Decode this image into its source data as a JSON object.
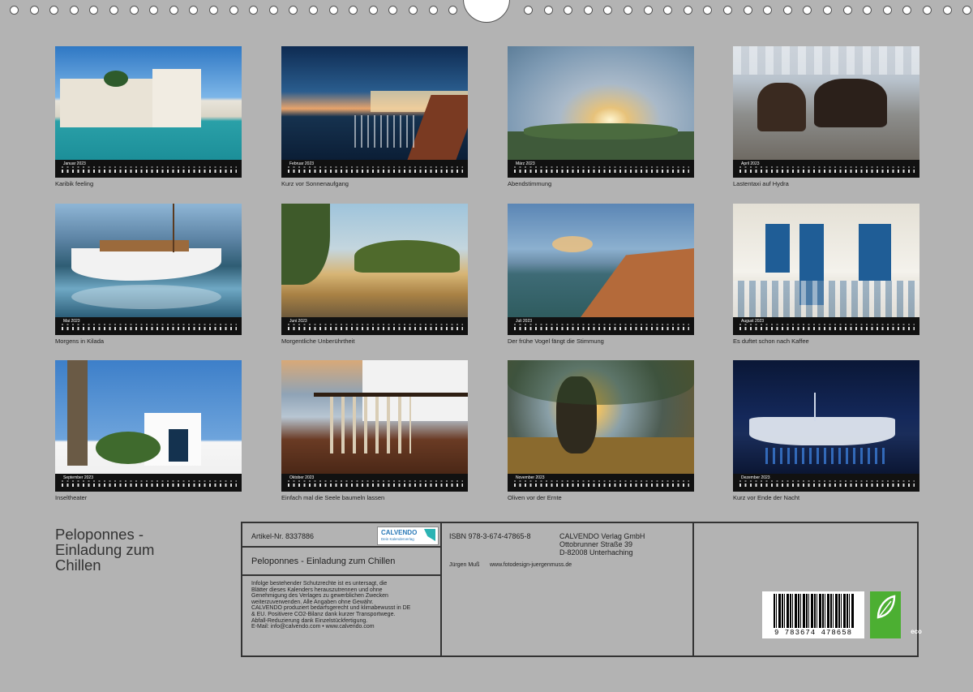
{
  "months": [
    {
      "label": "Januar 2023",
      "caption": "Karibik feeling"
    },
    {
      "label": "Februar 2023",
      "caption": "Kurz vor Sonnenaufgang"
    },
    {
      "label": "März 2023",
      "caption": "Abendstimmung"
    },
    {
      "label": "April 2023",
      "caption": "Lastentaxi auf Hydra"
    },
    {
      "label": "Mai 2023",
      "caption": "Morgens in Kilada"
    },
    {
      "label": "Juni 2023",
      "caption": "Morgentliche Unberührtheit"
    },
    {
      "label": "Juli 2023",
      "caption": "Der frühe Vogel fängt die Stimmung"
    },
    {
      "label": "August 2023",
      "caption": "Es duftet schon nach Kaffee"
    },
    {
      "label": "September 2023",
      "caption": "Inseltheater"
    },
    {
      "label": "Oktober 2023",
      "caption": "Einfach mal die Seele baumeln lassen"
    },
    {
      "label": "November 2023",
      "caption": "Oliven vor der Ernte"
    },
    {
      "label": "Dezember 2023",
      "caption": "Kurz vor Ende der Nacht"
    }
  ],
  "cover_title": {
    "line1": "Peloponnes -",
    "line2": "Einladung zum",
    "line3": "Chillen"
  },
  "info": {
    "article": "Artikel-Nr. 8337886",
    "logo_brand": "CALVENDO",
    "logo_tagline": "Dein Kalenderverlag",
    "product_title": "Peloponnes - Einladung zum Chillen",
    "legal": [
      "Infolge bestehender Schutzrechte ist es untersagt, die",
      "Blätter dieses Kalenders herauszutrennen und ohne",
      "Genehmigung des Verlages zu gewerblichen Zwecken",
      "weiterzuverwenden. Alle Angaben ohne Gewähr.",
      "CALVENDO produziert bedarfsgerecht und klimabewusst in DE",
      "& EU. Positivere CO2-Bilanz dank kurzer Transportwege.",
      "Abfall-Reduzierung dank Einzelstückfertigung.",
      "E-Mail: info@calvendo.com • www.calvendo.com"
    ],
    "isbn": "ISBN 978-3-674-47865-8",
    "publisher1": "CALVENDO Verlag GmbH",
    "publisher2": "Ottobrunner Straße 39",
    "publisher3": "D-82008 Unterhaching",
    "author": "Jürgen Muß",
    "website": "www.fotodesign-juergenmuss.de",
    "barcode": "9 783674 478658",
    "eco_label": "eco"
  },
  "colors": {
    "background": "#b3b3b3",
    "calendar_bar": "#111111",
    "eco_green": "#4caf32"
  }
}
